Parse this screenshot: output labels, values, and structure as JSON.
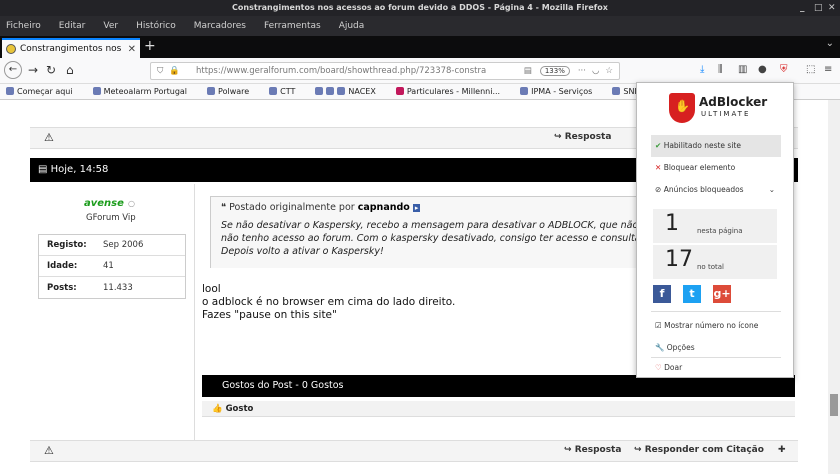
{
  "window": {
    "title": "Constrangimentos nos acessos ao forum devido a DDOS - Página 4 - Mozilla Firefox"
  },
  "menu": [
    "Ficheiro",
    "Editar",
    "Ver",
    "Histórico",
    "Marcadores",
    "Ferramentas",
    "Ajuda"
  ],
  "tab": {
    "label": "Constrangimentos nos"
  },
  "url": {
    "text": "https://www.geralforum.com/board/showthread.php/723378-constra",
    "zoom": "133%"
  },
  "bookmarks": [
    "Começar aqui",
    "Meteoalarm Portugal",
    "Polware",
    "CTT",
    "NACEX",
    "Particulares - Millenni...",
    "IPMA - Serviços",
    "SNIRH > Da"
  ],
  "actions": {
    "reply": "Resposta",
    "reply_quote": "Responder com Citação"
  },
  "post": {
    "date": "Hoje, 14:58",
    "username": "avense",
    "usertitle": "GForum Vip",
    "stats": [
      {
        "k": "Registo:",
        "v": "Sep 2006"
      },
      {
        "k": "Idade:",
        "v": "41"
      },
      {
        "k": "Posts:",
        "v": "11.433"
      }
    ],
    "quote_prefix": "Postado originalmente por",
    "quote_author": "capnando",
    "quote_lines": [
      "Se não desativar o Kaspersky, recebo a mensagem para desativar o ADBLOCK, que não",
      "não tenho acesso ao forum. Com o kaspersky desativado, consigo ter acesso e consultar",
      "Depois volto a ativar o Kaspersky!"
    ],
    "message": [
      "lool",
      "o adblock é no browser em cima do lado direito.",
      "Fazes \"pause on this site\""
    ],
    "likes_label": "Gostos do Post - 0 Gostos",
    "like_button": "Gosto"
  },
  "adblocker": {
    "name": "AdBlocker",
    "sub": "ULTIMATE",
    "enabled": "Habilitado neste site",
    "block_element": "Bloquear elemento",
    "blocked_ads": "Anúncios bloqueados",
    "page_count": "1",
    "page_label": "nesta página",
    "total_count": "17",
    "total_label": "no total",
    "show_count": "Mostrar número no ícone",
    "options": "Opções",
    "donate": "Doar",
    "colors": {
      "facebook": "#3b5998",
      "twitter": "#1da1f2",
      "google": "#dd4b39",
      "shield": "#d72020"
    }
  }
}
